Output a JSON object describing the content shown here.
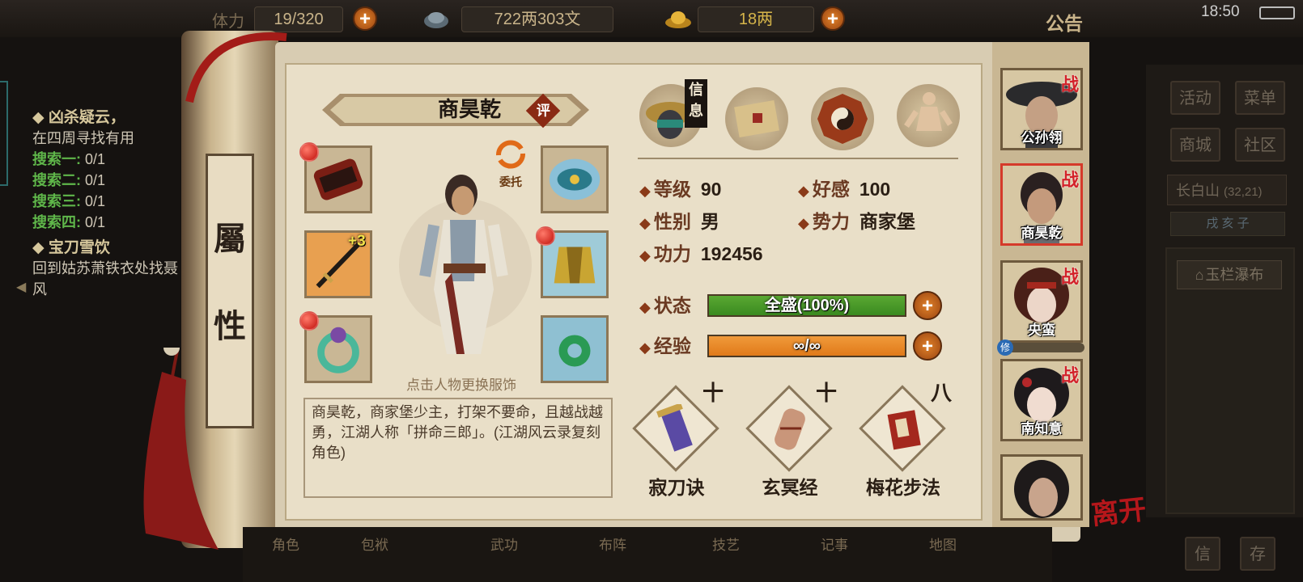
{
  "status_bar": {
    "time": "18:50"
  },
  "top_resources": {
    "stamina": {
      "label": "体力",
      "value": "19/320"
    },
    "coins": {
      "value": "722两303文"
    },
    "gold": {
      "value": "18两"
    },
    "notice_label": "公告"
  },
  "quests": [
    {
      "title": "◆ 凶杀疑云，",
      "desc": "在四周寻找有用",
      "tasks": [
        {
          "label": "搜索一:",
          "progress": "0/1"
        },
        {
          "label": "搜索二:",
          "progress": "0/1"
        },
        {
          "label": "搜索三:",
          "progress": "0/1"
        },
        {
          "label": "搜索四:",
          "progress": "0/1"
        }
      ]
    },
    {
      "title": "◆ 宝刀雪饮",
      "desc": "回到姑苏萧铁衣处找聂风"
    }
  ],
  "scroll_tab": {
    "char1": "屬",
    "char2": "性"
  },
  "character": {
    "name": "商昊乾",
    "rate_badge": "评",
    "entrust_label": "委托",
    "plus_badge": "+3",
    "hint": "点击人物更换服饰",
    "description": "商昊乾，商家堡少主，打架不要命，且越战越勇，江湖人称「拼命三郎」。(江湖风云录复刻角色)"
  },
  "tabs": {
    "info_label": "信息"
  },
  "stats": {
    "level": {
      "label": "等级",
      "value": "90"
    },
    "affection": {
      "label": "好感",
      "value": "100"
    },
    "gender": {
      "label": "性别",
      "value": "男"
    },
    "faction": {
      "label": "势力",
      "value": "商家堡"
    },
    "power": {
      "label": "功力",
      "value": "192456"
    },
    "state": {
      "label": "状态",
      "value": "全盛(100%)",
      "fraction": 1.0
    },
    "exp": {
      "label": "经验",
      "value": "∞/∞",
      "fraction": 1.0
    }
  },
  "skills": [
    {
      "name": "寂刀诀",
      "level": "十"
    },
    {
      "name": "玄冥经",
      "level": "十"
    },
    {
      "name": "梅花步法",
      "level": "八"
    }
  ],
  "roster": [
    {
      "name": "公孙翎",
      "tag": "战"
    },
    {
      "name": "商昊乾",
      "tag": "战"
    },
    {
      "name": "央蛮",
      "tag": "战",
      "sub": "修"
    },
    {
      "name": "南知意",
      "tag": "战"
    },
    {
      "name": ""
    }
  ],
  "side_menu": {
    "activity": "活动",
    "menu": "菜单",
    "shop": "商城",
    "community": "社区"
  },
  "location": {
    "name": "长白山",
    "coords": "(32,21)",
    "sub": "戌 亥 子",
    "marker": "玉栏瀑布"
  },
  "leave_label": "离开",
  "bottom_nav": [
    "角色",
    "包袱",
    "武功",
    "布阵",
    "技艺",
    "记事",
    "地图"
  ],
  "bottom_right": [
    "信",
    "存"
  ],
  "colors": {
    "state_bar": "#5aa832",
    "exp_bar": "#e07a1a",
    "accent_red": "#c3281e"
  }
}
